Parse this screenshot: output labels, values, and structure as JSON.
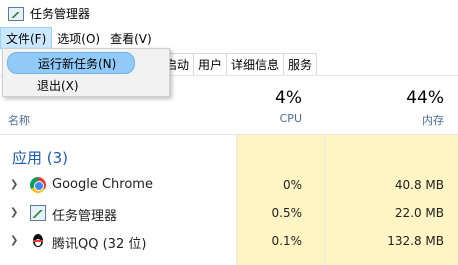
{
  "window": {
    "title": "任务管理器"
  },
  "menubar": {
    "file": "文件(F)",
    "options": "选项(O)",
    "view": "查看(V)"
  },
  "file_menu": {
    "run_new_task": "运行新任务(N)",
    "exit": "退出(X)"
  },
  "tabs": [
    "启动",
    "用户",
    "详细信息",
    "服务"
  ],
  "columns": {
    "name": "名称",
    "cpu_percent": "4%",
    "cpu_label": "CPU",
    "mem_percent": "44%",
    "mem_label": "内存"
  },
  "group": {
    "title": "应用 (3)"
  },
  "processes": [
    {
      "name": "Google Chrome",
      "cpu": "0%",
      "memory": "40.8 MB",
      "icon": "chrome-icon"
    },
    {
      "name": "任务管理器",
      "cpu": "0.5%",
      "memory": "22.0 MB",
      "icon": "task-manager-icon"
    },
    {
      "name": "腾讯QQ (32 位)",
      "cpu": "0.1%",
      "memory": "132.8 MB",
      "icon": "qq-icon"
    }
  ],
  "colors": {
    "highlight_column": "#fff4c4",
    "group_title": "#1e5bb5",
    "menu_highlight": "#91c9f7"
  }
}
